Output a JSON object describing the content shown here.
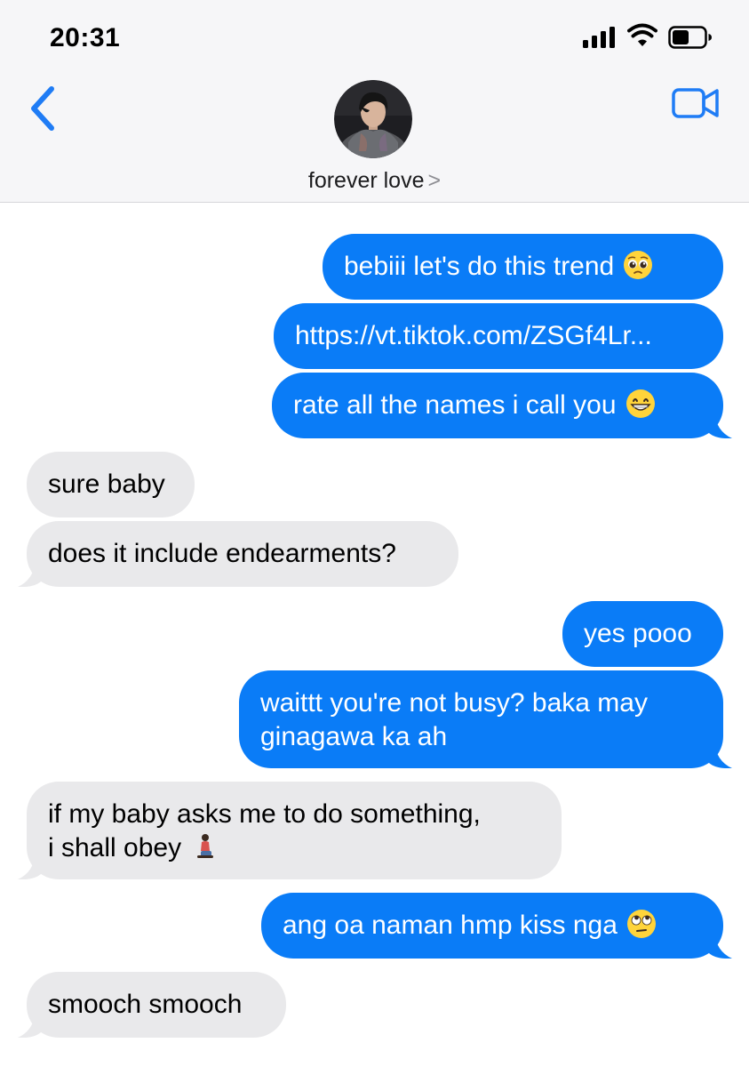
{
  "status_bar": {
    "time": "20:31"
  },
  "header": {
    "contact_name": "forever love",
    "chevron": ">"
  },
  "colors": {
    "sent_bubble": "#0a7cf7",
    "received_bubble": "#e9e9eb",
    "ios_blue": "#1f7cf5"
  },
  "messages": [
    {
      "direction": "sent",
      "text": "bebiii let's do this trend",
      "emoji": "pleading-face-emoji"
    },
    {
      "direction": "sent",
      "text": "https://vt.tiktok.com/ZSGf4Lr..."
    },
    {
      "direction": "sent",
      "text": "rate all the names i call you",
      "emoji": "grinning-face-emoji"
    },
    {
      "direction": "received",
      "text": "sure baby"
    },
    {
      "direction": "received",
      "text": "does it include endearments?"
    },
    {
      "direction": "sent",
      "text": "yes pooo"
    },
    {
      "direction": "sent",
      "line1": "waittt you're not busy? baka may",
      "line2": "ginagawa ka ah"
    },
    {
      "direction": "received",
      "line1": "if my baby asks me to do something,",
      "line2": "i shall obey",
      "emoji": "kneeling-person-emoji"
    },
    {
      "direction": "sent",
      "text": "ang oa naman hmp kiss nga",
      "emoji": "rolling-eyes-emoji"
    },
    {
      "direction": "received",
      "text": "smooch smooch"
    }
  ]
}
